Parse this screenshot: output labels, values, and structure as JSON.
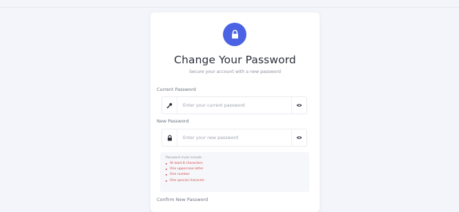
{
  "header": {
    "title": "Change Your Password",
    "subtitle": "Secure your account with a new password"
  },
  "colors": {
    "accent": "#4a62e3",
    "error": "#d14a4a"
  },
  "form": {
    "current_password": {
      "label": "Current Password",
      "placeholder": "Enter your current password",
      "lead_icon": "key-icon",
      "toggle_icon": "eye-icon"
    },
    "new_password": {
      "label": "New Password",
      "placeholder": "Enter your new password",
      "lead_icon": "lock-icon",
      "toggle_icon": "eye-icon"
    },
    "confirm_password": {
      "label": "Confirm New Password"
    }
  },
  "requirements": {
    "heading": "Password must include:",
    "items": [
      "At least 8 characters",
      "One uppercase letter",
      "One number",
      "One special character"
    ]
  }
}
